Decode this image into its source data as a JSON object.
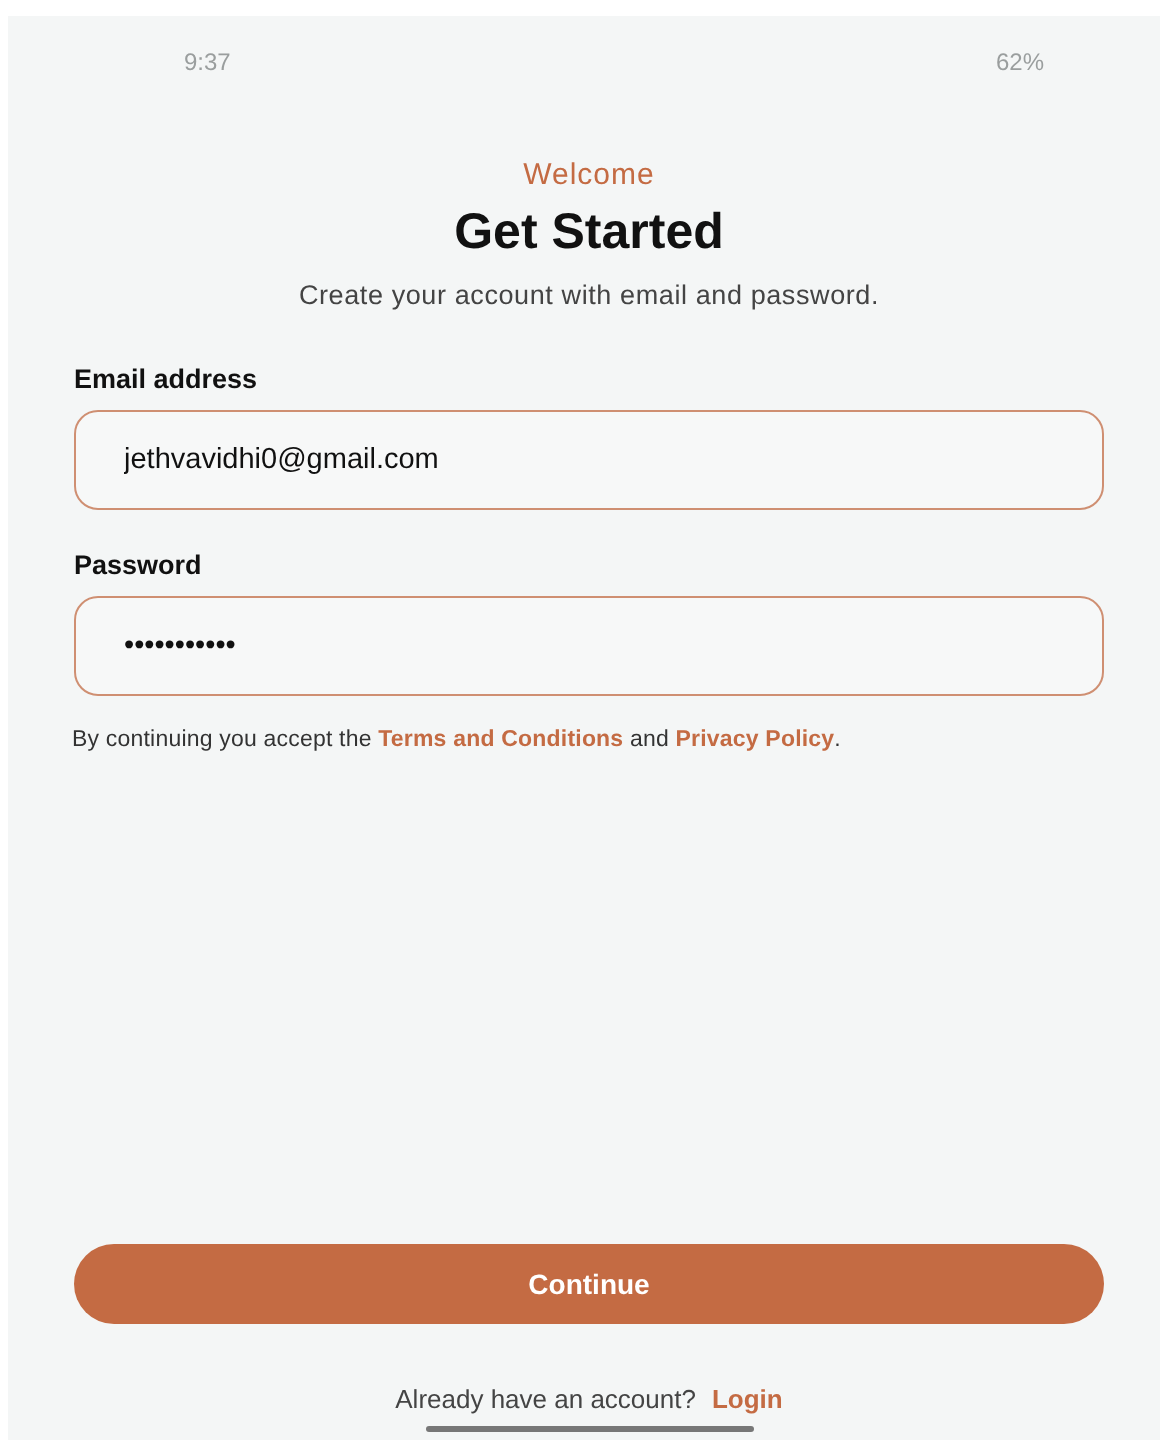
{
  "status_bar": {
    "time": "9:37",
    "battery": "62%"
  },
  "header": {
    "eyebrow": "Welcome",
    "title": "Get Started",
    "subtitle": "Create your account with email and password."
  },
  "fields": [
    {
      "label": "Email address",
      "value": "jethvavidhi0@gmail.com"
    },
    {
      "label": "Password",
      "value": "•••••••••••"
    }
  ],
  "terms": [
    {
      "kind": "text",
      "text": "By continuing you accept the "
    },
    {
      "kind": "link",
      "text": "Terms and Conditions"
    },
    {
      "kind": "text",
      "text": " and "
    },
    {
      "kind": "link",
      "text": "Privacy Policy"
    },
    {
      "kind": "text",
      "text": "."
    }
  ],
  "continue_button": "Continue",
  "footer": {
    "prompt": "Already have an account?",
    "link": "Login"
  }
}
